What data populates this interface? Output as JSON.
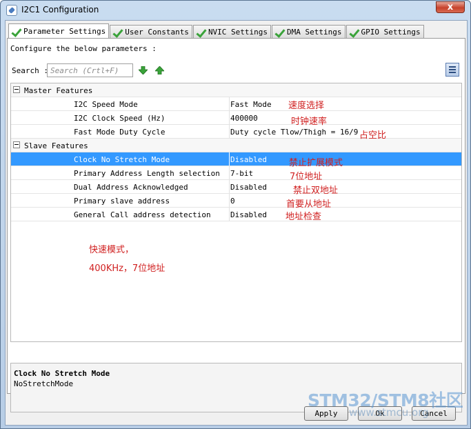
{
  "window": {
    "title": "I2C1 Configuration",
    "close_label": "x"
  },
  "tabs": [
    {
      "label": "Parameter Settings",
      "active": true
    },
    {
      "label": "User Constants",
      "active": false
    },
    {
      "label": "NVIC Settings",
      "active": false
    },
    {
      "label": "DMA Settings",
      "active": false
    },
    {
      "label": "GPIO Settings",
      "active": false
    }
  ],
  "panel": {
    "intro": "Configure the below parameters :",
    "search_label": "Search :",
    "search_placeholder": "Search (Crtl+F)"
  },
  "groups": [
    {
      "label": "Master Features",
      "rows": [
        {
          "name": "I2C Speed Mode",
          "value": "Fast Mode"
        },
        {
          "name": "I2C Clock Speed (Hz)",
          "value": "400000"
        },
        {
          "name": "Fast Mode Duty Cycle",
          "value": "Duty cycle Tlow/Thigh = 16/9"
        }
      ]
    },
    {
      "label": "Slave Features",
      "rows": [
        {
          "name": "Clock No Stretch Mode",
          "value": "Disabled",
          "selected": true
        },
        {
          "name": "Primary Address Length selection",
          "value": "7-bit"
        },
        {
          "name": "Dual Address Acknowledged",
          "value": "Disabled"
        },
        {
          "name": "Primary slave address",
          "value": "0"
        },
        {
          "name": "General Call address detection",
          "value": "Disabled"
        }
      ]
    }
  ],
  "annotations": {
    "speed": "速度选择",
    "clock": "时钟速率",
    "duty": "占空比",
    "nostretch": "禁止扩展模式",
    "addr7": "7位地址",
    "dual": "禁止双地址",
    "primary": "首要从地址",
    "general": "地址检查",
    "note1": "快速模式，",
    "note2": "400KHz，7位地址"
  },
  "description": {
    "title": "Clock No Stretch Mode",
    "text": "NoStretchMode"
  },
  "buttons": {
    "apply": "Apply",
    "ok": "Ok",
    "cancel": "Cancel"
  },
  "watermark": {
    "line1": "STM32/STM8社区",
    "line2": "www.stmcu.org"
  },
  "colors": {
    "selection": "#3399ff",
    "annotation": "#d02020",
    "check": "#3aa33a"
  }
}
